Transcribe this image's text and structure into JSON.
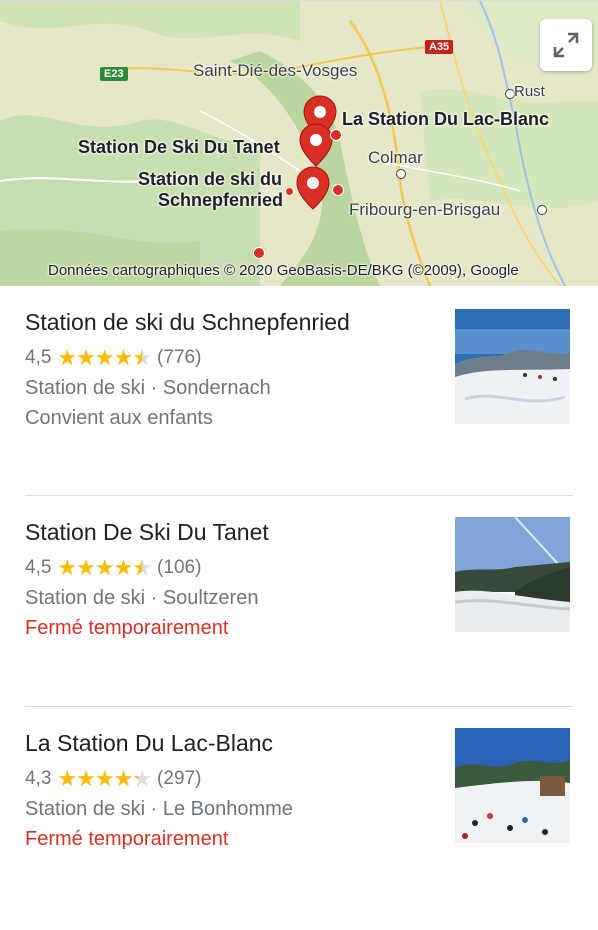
{
  "map": {
    "labels": {
      "saint_die": "Saint-Dié-des-Vosges",
      "rust": "Rust",
      "colmar": "Colmar",
      "fribourg": "Fribourg-en-Brisgau",
      "lac_blanc": "La Station Du Lac-Blanc",
      "tanet": "Station De Ski Du Tanet",
      "schnepf_line1": "Station de ski du",
      "schnepf_line2": "Schnepfenried"
    },
    "roads": {
      "e23": "E23",
      "a35": "A35"
    },
    "attribution": "Données cartographiques © 2020 GeoBasis-DE/BKG (©2009), Google",
    "expand_icon": "expand-icon",
    "pin_color": "#d93025"
  },
  "results": [
    {
      "title": "Station de ski du Schnepfenried",
      "rating": "4,5",
      "rating_value": 4.5,
      "reviews": "(776)",
      "category": "Station de ski · Sondernach",
      "status": "Convient aux enfants",
      "status_type": "info"
    },
    {
      "title": "Station De Ski Du Tanet",
      "rating": "4,5",
      "rating_value": 4.5,
      "reviews": "(106)",
      "category": "Station de ski · Soultzeren",
      "status": "Fermé temporairement",
      "status_type": "closed"
    },
    {
      "title": "La Station Du Lac-Blanc",
      "rating": "4,3",
      "rating_value": 4.3,
      "reviews": "(297)",
      "category": "Station de ski · Le Bonhomme",
      "status": "Fermé temporairement",
      "status_type": "closed"
    }
  ],
  "colors": {
    "star": "#fbbc04",
    "closed": "#d93025",
    "secondary_text": "#70757a"
  }
}
